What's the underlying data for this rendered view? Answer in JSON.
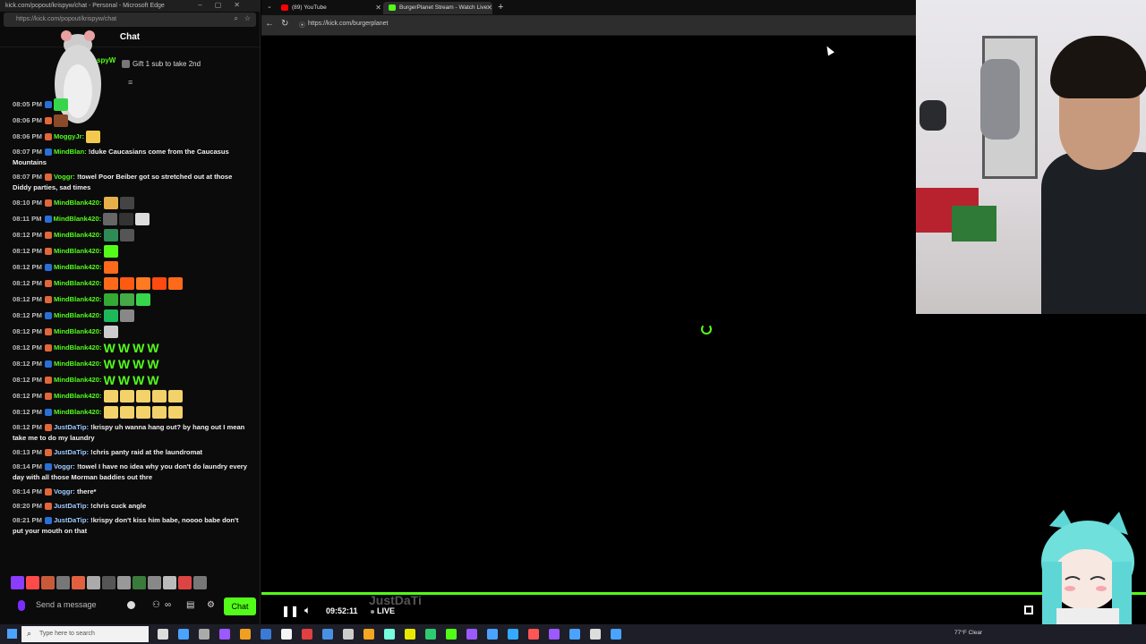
{
  "popout": {
    "title": "kick.com/popout/krispyw/chat - Personal - Microsoft Edge",
    "url": "https://kick.com/popout/krispyw/chat",
    "chat_heading": "Chat",
    "pinned_user": "spyW",
    "gift_text": "Gift 1 sub to take 2nd"
  },
  "messages": [
    {
      "time": "08:05 PM",
      "user": "",
      "color": "#53fc18",
      "text": "",
      "emotes": [
        "#37d64a"
      ]
    },
    {
      "time": "08:06 PM",
      "user": "",
      "color": "#53fc18",
      "text": "",
      "emotes": [
        "#8a4a2a"
      ]
    },
    {
      "time": "08:06 PM",
      "user": "MoggyJr",
      "color": "#53fc18",
      "text": "",
      "emotes": [
        "#f2c94c"
      ]
    },
    {
      "time": "08:07 PM",
      "user": "MindBlan",
      "color": "#53fc18",
      "text": "!duke Caucasians come from the Caucasus Mountains",
      "emotes": []
    },
    {
      "time": "08:07 PM",
      "user": "Voggr",
      "color": "#53fc18",
      "text": "!towel Poor Beiber got so stretched out at those Diddy parties, sad times",
      "emotes": []
    },
    {
      "time": "08:10 PM",
      "user": "MindBlank420",
      "color": "#53fc18",
      "text": "",
      "emotes": [
        "#e8b04a",
        "#444"
      ]
    },
    {
      "time": "08:11 PM",
      "user": "MindBlank420",
      "color": "#53fc18",
      "text": "",
      "emotes": [
        "#666",
        "#333",
        "#ddd"
      ]
    },
    {
      "time": "08:12 PM",
      "user": "MindBlank420",
      "color": "#53fc18",
      "text": "",
      "emotes": [
        "#2e8b57",
        "#555"
      ]
    },
    {
      "time": "08:12 PM",
      "user": "MindBlank420",
      "color": "#53fc18",
      "text": "",
      "emotes": [
        "#53fc18"
      ]
    },
    {
      "time": "08:12 PM",
      "user": "MindBlank420",
      "color": "#53fc18",
      "text": "",
      "emotes": [
        "#ff6a1a"
      ]
    },
    {
      "time": "08:12 PM",
      "user": "MindBlank420",
      "color": "#53fc18",
      "text": "",
      "emotes": [
        "#ff6a1a",
        "#ff5a10",
        "#ff7a20",
        "#ff4a10",
        "#ff6a1a"
      ]
    },
    {
      "time": "08:12 PM",
      "user": "MindBlank420",
      "color": "#53fc18",
      "text": "",
      "emotes": [
        "#3a3",
        "#4a4",
        "#37d64a"
      ]
    },
    {
      "time": "08:12 PM",
      "user": "MindBlank420",
      "color": "#53fc18",
      "text": "",
      "emotes": [
        "#1eb85a",
        "#888"
      ]
    },
    {
      "time": "08:12 PM",
      "user": "MindBlank420",
      "color": "#53fc18",
      "text": "",
      "emotes": [
        "#ccc"
      ]
    },
    {
      "time": "08:12 PM",
      "user": "MindBlank420",
      "color": "#53fc18",
      "text": "",
      "words": [
        "W",
        "W",
        "W",
        "W"
      ],
      "emotes": []
    },
    {
      "time": "08:12 PM",
      "user": "MindBlank420",
      "color": "#53fc18",
      "text": "",
      "words": [
        "W",
        "W",
        "W",
        "W"
      ],
      "emotes": []
    },
    {
      "time": "08:12 PM",
      "user": "MindBlank420",
      "color": "#53fc18",
      "text": "",
      "words": [
        "W",
        "W",
        "W",
        "W"
      ],
      "emotes": []
    },
    {
      "time": "08:12 PM",
      "user": "MindBlank420",
      "color": "#53fc18",
      "text": "",
      "emotes": [
        "#f4d26a",
        "#f4d26a",
        "#f4d26a",
        "#f4d26a",
        "#f4d26a"
      ]
    },
    {
      "time": "08:12 PM",
      "user": "MindBlank420",
      "color": "#53fc18",
      "text": "",
      "emotes": [
        "#f4d26a",
        "#f4d26a",
        "#f4d26a",
        "#f4d26a",
        "#f4d26a"
      ]
    },
    {
      "time": "08:12 PM",
      "user": "JustDaTip",
      "color": "#9ecbff",
      "text": "!krispy uh wanna hang out? by hang out I mean take me to do my laundry",
      "emotes": []
    },
    {
      "time": "08:13 PM",
      "user": "JustDaTip",
      "color": "#9ecbff",
      "text": "!chris panty raid at the laundromat",
      "emotes": []
    },
    {
      "time": "08:14 PM",
      "user": "Voggr",
      "color": "#9ecbff",
      "text": "!towel I have no idea why you don't do laundry every day with all those Morman baddies out thre",
      "emotes": []
    },
    {
      "time": "08:14 PM",
      "user": "Voggr",
      "color": "#9ecbff",
      "text": "there*",
      "emotes": []
    },
    {
      "time": "08:20 PM",
      "user": "JustDaTip",
      "color": "#9ecbff",
      "text": "!chris cuck angle",
      "emotes": []
    },
    {
      "time": "08:21 PM",
      "user": "JustDaTip",
      "color": "#9ecbff",
      "text": "!krispy don't kiss him babe, noooo babe don't put your mouth on that",
      "emotes": []
    }
  ],
  "emote_bar": [
    "#8a3cff",
    "#ff4a4a",
    "#c85a3a",
    "#777",
    "#e06040",
    "#aaa",
    "#555",
    "#999",
    "#3a7a3a",
    "#888",
    "#bbb",
    "#d44",
    "#777"
  ],
  "send": {
    "placeholder": "Send a message",
    "button": "Chat"
  },
  "browser": {
    "tab1": "(89) YouTube",
    "tab2": "BurgerPlanet Stream - Watch Live",
    "url": "https://kick.com/burgerplanet"
  },
  "player": {
    "timecode": "09:52:11",
    "live": "LIVE",
    "overlay_name": "JustDaTi"
  },
  "taskbar": {
    "search_placeholder": "Type here to search",
    "weather": "77°F Clear"
  },
  "taskbar_apps": [
    "#ddd",
    "#4aa3ff",
    "#aaa",
    "#9b59ff",
    "#f0a020",
    "#3a7bd5",
    "#f5f5f5",
    "#e04040",
    "#4a90e2",
    "#ccc",
    "#f5a623",
    "#7fd",
    "#e8e800",
    "#2ecc71",
    "#53fc18",
    "#9b59ff",
    "#4aa3ff",
    "#33aaff",
    "#f55",
    "#9b59ff",
    "#4aa3ff",
    "#ddd",
    "#4aa3ff"
  ],
  "colors": {
    "accent": "#53fc18",
    "background": "#000000"
  }
}
